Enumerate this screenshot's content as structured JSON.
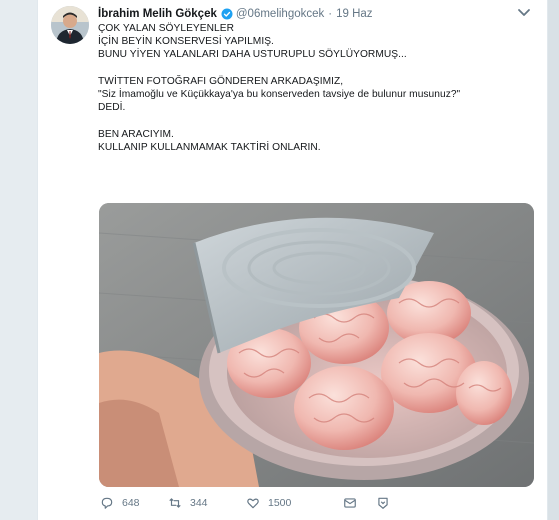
{
  "tweet": {
    "author_name": "İbrahim Melih Gökçek",
    "handle": "@06melihgokcek",
    "separator": "·",
    "time": "19 Haz",
    "text_lines": [
      "ÇOK YALAN SÖYLEYENLER",
      "İÇİN BEYİN KONSERVESİ YAPILMIŞ.",
      "BUNU YİYEN YALANLARI DAHA USTURUPLU SÖYLÜYORMUŞ...",
      "",
      "TWİTTEN FOTOĞRAFI GÖNDEREN ARKADAŞIMIZ,",
      "\"Siz İmamoğlu ve Küçükkaya'ya bu konserveden tavsiye de bulunur musunuz?\"",
      "DEDİ.",
      "",
      "BEN ARACIYIM.",
      "KULLANIP KULLANMAMAK TAKTİRİ ONLARIN."
    ]
  },
  "actions": {
    "reply_count": "648",
    "retweet_count": "344",
    "like_count": "1500"
  },
  "icons": {
    "verified": "verified-badge-icon",
    "caret": "chevron-down-icon",
    "reply": "reply-icon",
    "retweet": "retweet-icon",
    "like": "heart-icon",
    "dm": "envelope-icon",
    "more": "more-icon"
  },
  "colors": {
    "accent": "#1da1f2",
    "muted": "#657786",
    "text": "#14171a",
    "background": "#e6ecf0"
  }
}
